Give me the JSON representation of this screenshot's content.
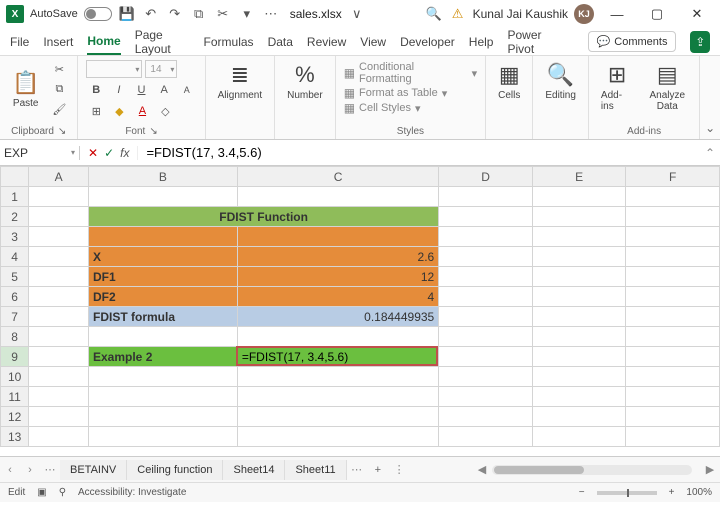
{
  "titlebar": {
    "app_abbrev": "X",
    "autosave_label": "AutoSave",
    "filename": "sales.xlsx",
    "dropdown_glyph": "∨",
    "search_icon": "🔍",
    "warning_icon": "⚠",
    "username": "Kunal Jai Kaushik",
    "user_initials": "KJ",
    "minimize": "—",
    "maximize": "▢",
    "close": "✕"
  },
  "qat": {
    "save": "💾",
    "undo": "↶",
    "redo": "↷",
    "copy": "⧉",
    "cut": "✂",
    "down": "▾",
    "more": "⋯"
  },
  "tabs": {
    "file": "File",
    "insert": "Insert",
    "home": "Home",
    "page_layout": "Page Layout",
    "formulas": "Formulas",
    "data": "Data",
    "review": "Review",
    "view": "View",
    "developer": "Developer",
    "help": "Help",
    "power_pivot": "Power Pivot",
    "comments": "Comments",
    "comments_icon": "💬",
    "share_icon": "⇪"
  },
  "ribbon": {
    "clipboard": {
      "paste": "Paste",
      "paste_icon": "📋",
      "label": "Clipboard",
      "launcher": "↘"
    },
    "font": {
      "font_placeholder": "",
      "size_placeholder": "14",
      "bold": "B",
      "italic": "I",
      "underline": "U",
      "grow": "A",
      "shrink": "A",
      "border": "⊞",
      "fill": "◆",
      "color": "A",
      "clear": "◇",
      "label": "Font",
      "launcher": "↘"
    },
    "alignment": {
      "icon": "≣",
      "label": "Alignment"
    },
    "number": {
      "icon": "%",
      "label": "Number"
    },
    "styles": {
      "cf": "Conditional Formatting",
      "cf_icon": "▦",
      "table": "Format as Table",
      "table_icon": "▦",
      "cell": "Cell Styles",
      "cell_icon": "▦",
      "label": "Styles"
    },
    "cells": {
      "icon": "▦",
      "label": "Cells"
    },
    "editing": {
      "icon": "🔍",
      "label": "Editing"
    },
    "addins": {
      "icon": "⊞",
      "label": "Add-ins",
      "group_label": "Add-ins"
    },
    "analyze": {
      "icon": "▤",
      "label": "Analyze Data"
    },
    "collapse": "⌄"
  },
  "formula_bar": {
    "name_box": "EXP",
    "cancel": "✕",
    "confirm": "✓",
    "fx": "fx",
    "formula": "=FDIST(17, 3.4,5.6)",
    "expand": "⌃"
  },
  "grid": {
    "columns": [
      "A",
      "B",
      "C",
      "D",
      "E",
      "F"
    ],
    "rows": [
      {
        "n": 1,
        "cells": [
          "",
          "",
          "",
          "",
          "",
          ""
        ]
      },
      {
        "n": 2,
        "cells": [
          "",
          {
            "text": "FDIST Function",
            "colspan": 2,
            "cls": "green-header"
          },
          null,
          "",
          "",
          ""
        ]
      },
      {
        "n": 3,
        "cells": [
          "",
          {
            "text": "",
            "cls": "orange"
          },
          {
            "text": "",
            "cls": "orange-right"
          },
          "",
          "",
          ""
        ]
      },
      {
        "n": 4,
        "cells": [
          "",
          {
            "text": "X",
            "cls": "orange"
          },
          {
            "text": "2.6",
            "cls": "orange-right"
          },
          "",
          "",
          ""
        ]
      },
      {
        "n": 5,
        "cells": [
          "",
          {
            "text": "DF1",
            "cls": "orange"
          },
          {
            "text": "12",
            "cls": "orange-right"
          },
          "",
          "",
          ""
        ]
      },
      {
        "n": 6,
        "cells": [
          "",
          {
            "text": "DF2",
            "cls": "orange"
          },
          {
            "text": "4",
            "cls": "orange-right"
          },
          "",
          "",
          ""
        ]
      },
      {
        "n": 7,
        "cells": [
          "",
          {
            "text": "FDIST formula",
            "cls": "blue-row"
          },
          {
            "text": "0.184449935",
            "cls": "blue-right"
          },
          "",
          "",
          ""
        ]
      },
      {
        "n": 8,
        "cells": [
          "",
          "",
          "",
          "",
          "",
          ""
        ]
      },
      {
        "n": 9,
        "active": true,
        "cells": [
          "",
          {
            "text": "Example 2",
            "cls": "green-row"
          },
          {
            "text": "=FDIST(17, 3.4,5.6)",
            "cls": "active-cell",
            "active": true
          },
          "",
          "",
          ""
        ]
      },
      {
        "n": 10,
        "cells": [
          "",
          "",
          "",
          "",
          "",
          ""
        ]
      },
      {
        "n": 11,
        "cells": [
          "",
          "",
          "",
          "",
          "",
          ""
        ]
      },
      {
        "n": 12,
        "cells": [
          "",
          "",
          "",
          "",
          "",
          ""
        ]
      },
      {
        "n": 13,
        "cells": [
          "",
          "",
          "",
          "",
          "",
          ""
        ]
      }
    ]
  },
  "sheetbar": {
    "prev": "‹",
    "next": "›",
    "more": "⋯",
    "tabs": [
      "BETAINV",
      "Ceiling function",
      "Sheet14",
      "Sheet11"
    ],
    "overflow": "⋯",
    "add": "+",
    "menu": "⋮"
  },
  "statusbar": {
    "mode": "Edit",
    "rec_icon": "▣",
    "acc_icon": "⚲",
    "accessibility": "Accessibility: Investigate",
    "minus": "−",
    "plus": "+",
    "zoom": "100%"
  }
}
